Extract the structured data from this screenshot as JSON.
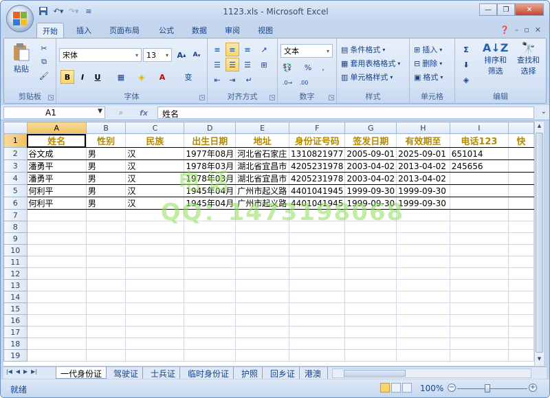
{
  "window": {
    "title": "1123.xls - Microsoft Excel"
  },
  "tabs": [
    "开始",
    "插入",
    "页面布局",
    "公式",
    "数据",
    "审阅",
    "视图"
  ],
  "ribbon": {
    "clipboard": {
      "paste": "粘贴",
      "label": "剪贴板"
    },
    "font": {
      "name": "宋体",
      "size": "13",
      "bold": "B",
      "italic": "I",
      "underline": "U",
      "wen": "变",
      "label": "字体"
    },
    "alignment": {
      "label": "对齐方式"
    },
    "number": {
      "format": "文本",
      "percent": "%",
      "comma": ",",
      "label": "数字"
    },
    "styles": {
      "conditional": "条件格式",
      "table": "套用表格格式",
      "cell": "单元格样式",
      "label": "样式"
    },
    "cells": {
      "insert": "插入",
      "delete": "删除",
      "format": "格式",
      "label": "单元格"
    },
    "editing": {
      "sort": "排序和",
      "filter": "筛选",
      "find": "查找和",
      "select": "选择",
      "label": "编辑"
    }
  },
  "formula_bar": {
    "name_box": "A1",
    "fx": "fx",
    "content": "姓名"
  },
  "columns": [
    "A",
    "B",
    "C",
    "D",
    "E",
    "F",
    "G",
    "H",
    "I"
  ],
  "rows": [
    {
      "n": "1",
      "cells": [
        "姓名",
        "性别",
        "民族",
        "出生日期",
        "地址",
        "身份证号码",
        "签发日期",
        "有效期至",
        "电话123",
        "快"
      ]
    },
    {
      "n": "2",
      "cells": [
        "谷文成",
        "男",
        "汉",
        "1977年08月",
        "河北省石家庄",
        "1310821977",
        "2005-09-01",
        "2025-09-01",
        "651014",
        ""
      ]
    },
    {
      "n": "3",
      "cells": [
        "潘勇平",
        "男",
        "汉",
        "1978年03月",
        "湖北省宜昌市",
        "4205231978",
        "2003-04-02",
        "2013-04-02",
        "245656",
        ""
      ]
    },
    {
      "n": "4",
      "cells": [
        "潘勇平",
        "男",
        "汉",
        "1978年03月",
        "湖北省宜昌市",
        "4205231978",
        "2003-04-02",
        "2013-04-02",
        "",
        ""
      ]
    },
    {
      "n": "5",
      "cells": [
        "何利平",
        "男",
        "汉",
        "1945年04月",
        "广州市起义路",
        "4401041945",
        "1999-09-30",
        "1999-09-30",
        "",
        ""
      ]
    },
    {
      "n": "6",
      "cells": [
        "何利平",
        "男",
        "汉",
        "1945年04月",
        "广州市起义路",
        "4401041945",
        "1999-09-30",
        "1999-09-30",
        "",
        ""
      ]
    },
    {
      "n": "7",
      "cells": [
        "",
        "",
        "",
        "",
        "",
        "",
        "",
        "",
        "",
        ""
      ]
    },
    {
      "n": "8",
      "cells": [
        "",
        "",
        "",
        "",
        "",
        "",
        "",
        "",
        "",
        ""
      ]
    },
    {
      "n": "9",
      "cells": [
        "",
        "",
        "",
        "",
        "",
        "",
        "",
        "",
        "",
        ""
      ]
    },
    {
      "n": "10",
      "cells": [
        "",
        "",
        "",
        "",
        "",
        "",
        "",
        "",
        "",
        ""
      ]
    },
    {
      "n": "11",
      "cells": [
        "",
        "",
        "",
        "",
        "",
        "",
        "",
        "",
        "",
        ""
      ]
    },
    {
      "n": "12",
      "cells": [
        "",
        "",
        "",
        "",
        "",
        "",
        "",
        "",
        "",
        ""
      ]
    },
    {
      "n": "13",
      "cells": [
        "",
        "",
        "",
        "",
        "",
        "",
        "",
        "",
        "",
        ""
      ]
    },
    {
      "n": "14",
      "cells": [
        "",
        "",
        "",
        "",
        "",
        "",
        "",
        "",
        "",
        ""
      ]
    },
    {
      "n": "15",
      "cells": [
        "",
        "",
        "",
        "",
        "",
        "",
        "",
        "",
        "",
        ""
      ]
    },
    {
      "n": "16",
      "cells": [
        "",
        "",
        "",
        "",
        "",
        "",
        "",
        "",
        "",
        ""
      ]
    },
    {
      "n": "17",
      "cells": [
        "",
        "",
        "",
        "",
        "",
        "",
        "",
        "",
        "",
        ""
      ]
    },
    {
      "n": "18",
      "cells": [
        "",
        "",
        "",
        "",
        "",
        "",
        "",
        "",
        "",
        ""
      ]
    },
    {
      "n": "19",
      "cells": [
        "",
        "",
        "",
        "",
        "",
        "",
        "",
        "",
        "",
        ""
      ]
    }
  ],
  "sheet_tabs": [
    "一代身份证",
    "驾驶证",
    "士兵证",
    "临时身份证",
    "护照",
    "回乡证",
    "港澳"
  ],
  "status": {
    "text": "就绪",
    "zoom": "100%"
  },
  "watermark": {
    "line1": "电话",
    "line2": "QQ：1473198068"
  },
  "colors": {
    "header_text": "#b38a00",
    "accent": "#15428b"
  }
}
